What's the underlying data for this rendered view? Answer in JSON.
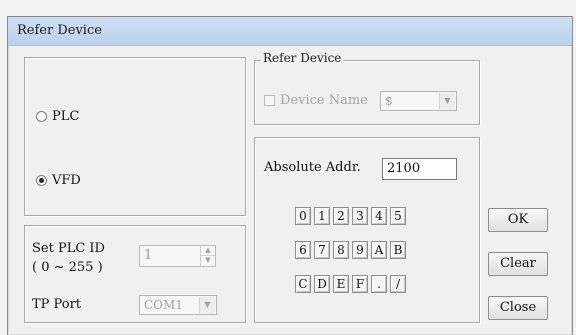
{
  "window": {
    "title": "Refer Device"
  },
  "mode": {
    "options": [
      {
        "label": "PLC",
        "selected": false
      },
      {
        "label": "VFD",
        "selected": true
      }
    ]
  },
  "refer_device": {
    "group_title": "Refer Device",
    "checkbox_label": "Device Name",
    "combo_value": "$"
  },
  "address": {
    "label": "Absolute Addr.",
    "value": "2100"
  },
  "keypad": {
    "row1": [
      "0",
      "1",
      "2",
      "3",
      "4",
      "5"
    ],
    "row2": [
      "6",
      "7",
      "8",
      "9",
      "A",
      "B"
    ],
    "row3": [
      "C",
      "D",
      "E",
      "F",
      ".",
      "/"
    ]
  },
  "plc_settings": {
    "plc_id_label": "Set PLC ID",
    "plc_id_range": "( 0 ~ 255 )",
    "plc_id_value": "1",
    "tp_port_label": "TP Port",
    "tp_port_value": "COM1"
  },
  "buttons": {
    "ok": "OK",
    "clear": "Clear",
    "close": "Close"
  }
}
